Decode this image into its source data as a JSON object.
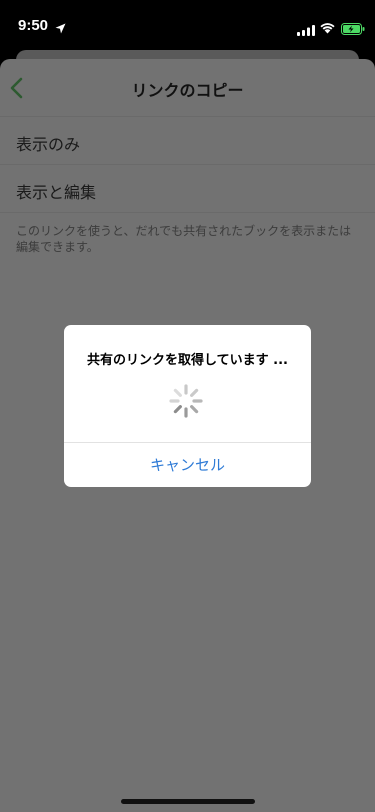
{
  "status_bar": {
    "time": "9:50",
    "icons": [
      "location-arrow-icon",
      "cellular-signal-icon",
      "wifi-icon",
      "battery-charging-icon"
    ],
    "battery_color": "#4cd964"
  },
  "nav": {
    "back_icon": "chevron-left-icon",
    "title": "リンクのコピー",
    "accent_color": "#2e7d32"
  },
  "options": [
    {
      "label": "表示のみ"
    },
    {
      "label": "表示と編集"
    }
  ],
  "description": "このリンクを使うと、だれでも共有されたブックを表示または編集できます。",
  "dialog": {
    "message": "共有のリンクを取得しています ...",
    "spinner_icon": "activity-spinner-icon",
    "cancel_label": "キャンセル",
    "cancel_color": "#2f7bd6"
  }
}
